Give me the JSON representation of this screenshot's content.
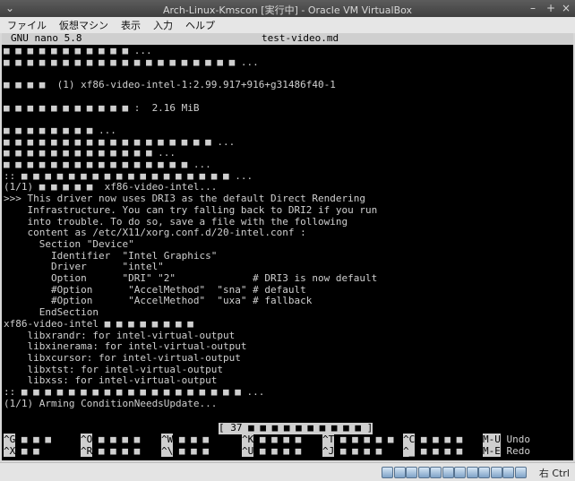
{
  "window": {
    "title": "Arch-Linux-Kmscon [実行中] - Oracle VM VirtualBox",
    "menu_icon": "chevron-down-icon",
    "minimize": "–",
    "maximize": "+",
    "close": "×"
  },
  "menu": [
    "ファイル",
    "仮想マシン",
    "表示",
    "入力",
    "ヘルプ"
  ],
  "nano": {
    "version": "GNU nano 5.8",
    "filename": "test-video.md",
    "status_message": "[ 37 ■ ■ ■ ■ ■ ■ ■ ■ ■ ■ ]"
  },
  "terminal_lines": [
    "■ ■ ■ ■ ■ ■ ■ ■ ■ ■ ■ ...",
    "■ ■ ■ ■ ■ ■ ■ ■ ■ ■ ■ ■ ■ ■ ■ ■ ■ ■ ■ ■ ...",
    "",
    "■ ■ ■ ■  (1) xf86-video-intel-1:2.99.917+916+g31486f40-1",
    "",
    "■ ■ ■ ■ ■ ■ ■ ■ ■ ■ ■ :  2.16 MiB",
    "",
    "■ ■ ■ ■ ■ ■ ■ ■ ...",
    "■ ■ ■ ■ ■ ■ ■ ■ ■ ■ ■ ■ ■ ■ ■ ■ ■ ■ ...",
    "■ ■ ■ ■ ■ ■ ■ ■ ■ ■ ■ ■ ■ ...",
    "■ ■ ■ ■ ■ ■ ■ ■ ■ ■ ■ ■ ■ ■ ■ ■ ...",
    ":: ■ ■ ■ ■ ■ ■ ■ ■ ■ ■ ■ ■ ■ ■ ■ ■ ■ ■ ...",
    "(1/1) ■ ■ ■ ■ ■  xf86-video-intel...",
    ">>> This driver now uses DRI3 as the default Direct Rendering",
    "    Infrastructure. You can try falling back to DRI2 if you run",
    "    into trouble. To do so, save a file with the following",
    "    content as /etc/X11/xorg.conf.d/20-intel.conf :",
    "      Section \"Device\"",
    "        Identifier  \"Intel Graphics\"",
    "        Driver      \"intel\"",
    "        Option      \"DRI\" \"2\"             # DRI3 is now default",
    "        #Option      \"AccelMethod\"  \"sna\" # default",
    "        #Option      \"AccelMethod\"  \"uxa\" # fallback",
    "      EndSection",
    "xf86-video-intel ■ ■ ■ ■ ■ ■ ■ ■",
    "    libxrandr: for intel-virtual-output",
    "    libxinerama: for intel-virtual-output",
    "    libxcursor: for intel-virtual-output",
    "    libxtst: for intel-virtual-output",
    "    libxss: for intel-virtual-output",
    ":: ■ ■ ■ ■ ■ ■ ■ ■ ■ ■ ■ ■ ■ ■ ■ ■ ■ ■ ■ ...",
    "(1/1) Arming ConditionNeedsUpdate..."
  ],
  "shortcuts_row1": [
    {
      "key": "^G",
      "label": "■ ■ ■"
    },
    {
      "key": "^O",
      "label": "■ ■ ■ ■"
    },
    {
      "key": "^W",
      "label": "■ ■ ■"
    },
    {
      "key": "^K",
      "label": "■ ■ ■ ■"
    },
    {
      "key": "^T",
      "label": "■ ■ ■ ■ ■"
    },
    {
      "key": "^C",
      "label": "■ ■ ■ ■"
    },
    {
      "key": "M-U",
      "label": "Undo"
    }
  ],
  "shortcuts_row2": [
    {
      "key": "^X",
      "label": "■ ■"
    },
    {
      "key": "^R",
      "label": "■ ■ ■ ■"
    },
    {
      "key": "^\\",
      "label": "■ ■ ■"
    },
    {
      "key": "^U",
      "label": "■ ■ ■ ■"
    },
    {
      "key": "^J",
      "label": "■ ■ ■ ■"
    },
    {
      "key": "^_",
      "label": "■ ■ ■ ■"
    },
    {
      "key": "M-E",
      "label": "Redo"
    }
  ],
  "statusbar": {
    "icons": [
      "hard-disk-icon",
      "optical-drive-icon",
      "audio-icon",
      "network-icon",
      "usb-icon",
      "shared-folder-icon",
      "display-icon",
      "video-capture-icon",
      "recording-icon",
      "cpu-icon",
      "mouse-integration-icon",
      "keyboard-icon"
    ],
    "host_key": "右 Ctrl"
  }
}
